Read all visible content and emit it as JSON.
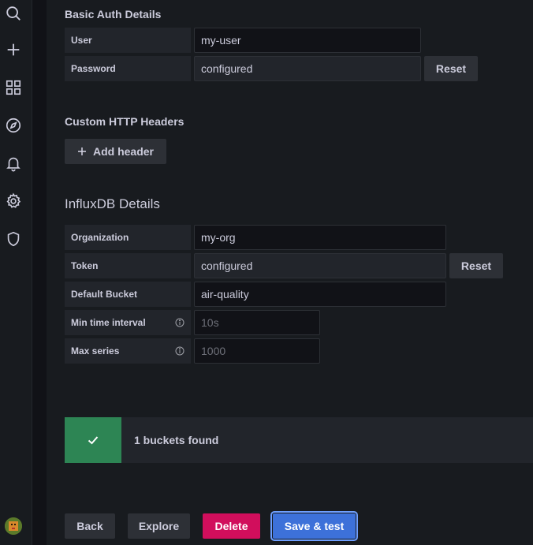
{
  "sidebar": {
    "icons": [
      "search-icon",
      "plus-icon",
      "dashboards-icon",
      "explore-compass-icon",
      "alerting-bell-icon",
      "configuration-gear-icon",
      "server-admin-shield-icon"
    ]
  },
  "basic_auth": {
    "title": "Basic Auth Details",
    "user_label": "User",
    "user_value": "my-user",
    "password_label": "Password",
    "password_value": "configured",
    "reset_label": "Reset"
  },
  "custom_headers": {
    "title": "Custom HTTP Headers",
    "add_header_label": "Add header"
  },
  "influx": {
    "title": "InfluxDB Details",
    "organization_label": "Organization",
    "organization_value": "my-org",
    "token_label": "Token",
    "token_value": "configured",
    "reset_label": "Reset",
    "bucket_label": "Default Bucket",
    "bucket_value": "air-quality",
    "min_interval_label": "Min time interval",
    "min_interval_placeholder": "10s",
    "max_series_label": "Max series",
    "max_series_placeholder": "1000"
  },
  "alert": {
    "message": "1 buckets found",
    "status_color": "#2d8554"
  },
  "actions": {
    "back_label": "Back",
    "explore_label": "Explore",
    "delete_label": "Delete",
    "save_label": "Save & test"
  },
  "colors": {
    "primary": "#3d71d9",
    "danger": "#d10e5c",
    "success": "#2d8554"
  }
}
